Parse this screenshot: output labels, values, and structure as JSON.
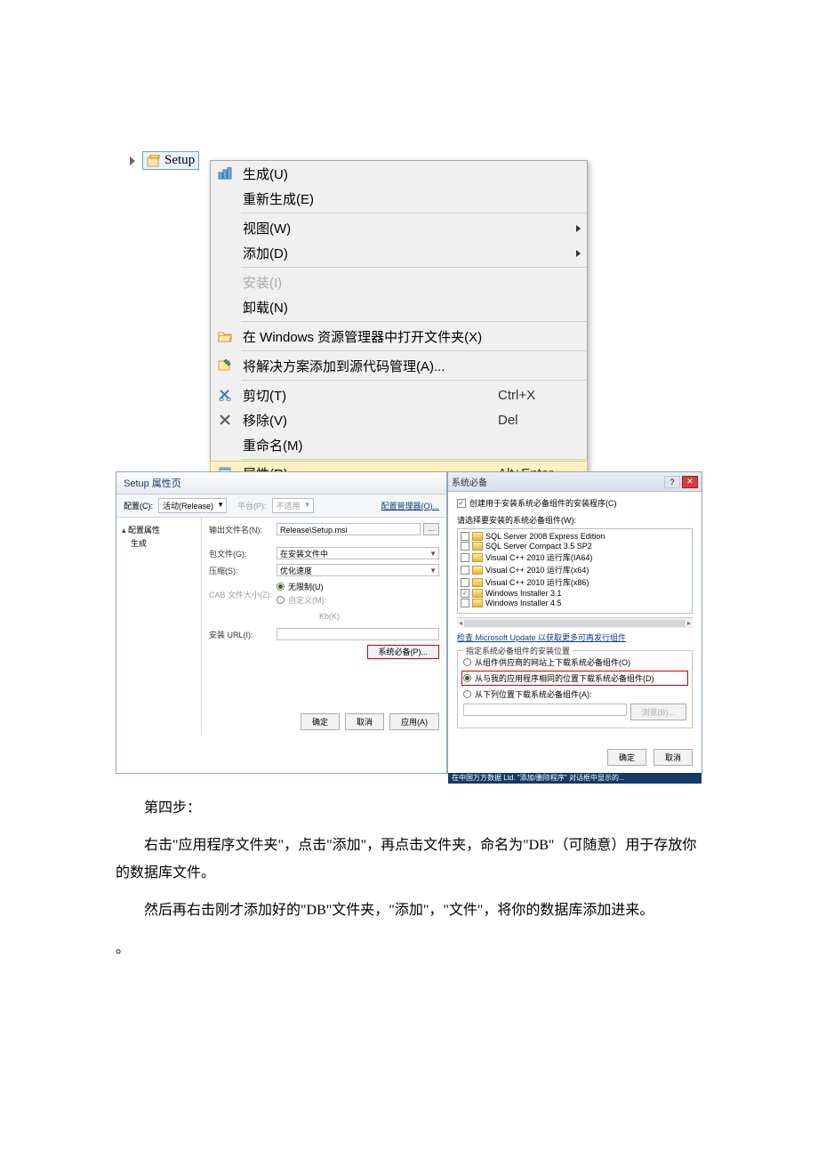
{
  "colors": {
    "highlight": "#d40000"
  },
  "solution": {
    "setup_label": "Setup"
  },
  "context_menu": {
    "build": "生成(U)",
    "rebuild": "重新生成(E)",
    "view": "视图(W)",
    "add": "添加(D)",
    "install": "安装(I)",
    "uninstall": "卸载(N)",
    "open_explorer": "在 Windows 资源管理器中打开文件夹(X)",
    "add_to_source_control": "将解决方案添加到源代码管理(A)...",
    "cut": "剪切(T)",
    "cut_shortcut": "Ctrl+X",
    "remove": "移除(V)",
    "remove_shortcut": "Del",
    "rename": "重命名(M)",
    "properties": "属性(R)",
    "properties_shortcut": "Alt+Enter"
  },
  "prop_page": {
    "title": "Setup 属性页",
    "config_label": "配置(C):",
    "config_value": "活动(Release)",
    "platform_label": "平台(P):",
    "platform_value": "不适用",
    "config_manager": "配置管理器(O)...",
    "tree_root": "配置属性",
    "tree_leaf": "生成",
    "output_label": "输出文件名(N):",
    "output_value": "Release\\Setup.msi",
    "package_label": "包文件(G):",
    "package_value": "在安装文件中",
    "compress_label": "压缩(S):",
    "compress_value": "优化速度",
    "cab_label": "CAB 文件大小(Z):",
    "cab_unlimited": "无限制(U)",
    "cab_custom": "自定义(M):",
    "kb_label": "Kb(K)",
    "url_label": "安装 URL(I):",
    "prereq_btn": "系统必备(P)...",
    "ok": "确定",
    "cancel": "取消",
    "apply": "应用(A)"
  },
  "prereq_dialog": {
    "title": "系统必备",
    "create_setup_cb": "创建用于安装系统必备组件的安装程序(C)",
    "choose_label": "请选择要安装的系统必备组件(W):",
    "items": [
      {
        "label": "SQL Server 2008 Express Edition",
        "checked": false
      },
      {
        "label": "SQL Server Compact 3.5 SP2",
        "checked": false
      },
      {
        "label": "Visual C++ 2010 运行库(IA64)",
        "checked": false
      },
      {
        "label": "Visual C++ 2010 运行库(x64)",
        "checked": false
      },
      {
        "label": "Visual C++ 2010 运行库(x86)",
        "checked": false
      },
      {
        "label": "Windows Installer 3.1",
        "checked": true
      },
      {
        "label": "Windows Installer 4.5",
        "checked": false
      }
    ],
    "update_link": "检查 Microsoft Update 以获取更多可再发行组件",
    "group_legend": "指定系统必备组件的安装位置",
    "radio_vendor": "从组件供应商的网站上下载系统必备组件(O)",
    "radio_same": "从与我的应用程序相同的位置下载系统必备组件(D)",
    "radio_path": "从下列位置下载系统必备组件(A):",
    "browse": "浏览(B)...",
    "ok": "确定",
    "cancel": "取消",
    "status_strip": "在中国万方数据 Ltd. \"添加/删除程序\" 对话框中显示的..."
  },
  "article": {
    "step4": "第四步：",
    "p1": "右击\"应用程序文件夹\"，点击\"添加\"，再点击文件夹，命名为\"DB\"（可随意）用于存放你的数据库文件。",
    "p2": "然后再右击刚才添加好的\"DB\"文件夹，\"添加\"，\"文件\"，将你的数据库添加进来。"
  }
}
